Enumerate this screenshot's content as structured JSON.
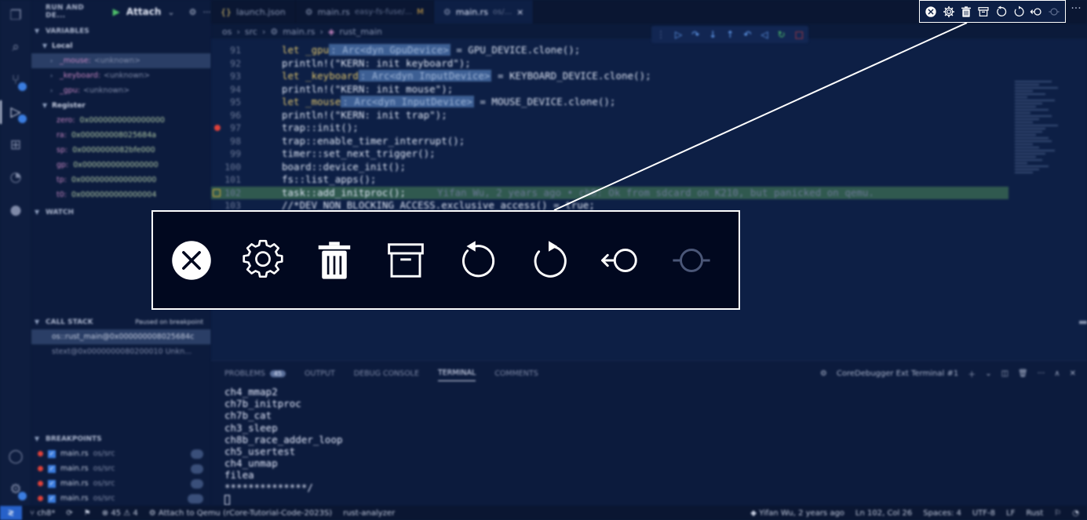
{
  "sidebar": {
    "run_label": "RUN AND DE...",
    "config": "Attach",
    "sections": {
      "variables": "VARIABLES",
      "local": "Local",
      "register": "Register",
      "watch": "WATCH",
      "call_stack": "CALL STACK",
      "call_stack_status": "Paused on breakpoint",
      "breakpoints": "BREAKPOINTS"
    },
    "locals": [
      {
        "name": "_mouse:",
        "value": "<unknown>"
      },
      {
        "name": "_keyboard:",
        "value": "<unknown>"
      },
      {
        "name": "_gpu:",
        "value": "<unknown>"
      }
    ],
    "registers": [
      {
        "name": "zero:",
        "value": "0x0000000000000000"
      },
      {
        "name": "ra:",
        "value": "0x000000008025684a"
      },
      {
        "name": "sp:",
        "value": "0x0000000082bfe000"
      },
      {
        "name": "gp:",
        "value": "0x0000000000000000"
      },
      {
        "name": "tp:",
        "value": "0x0000000000000000"
      },
      {
        "name": "t0:",
        "value": "0x0000000000000004"
      }
    ],
    "frames": [
      "os::rust_main@0x000000008025684c",
      "stext@0x0000000080200010  Unkn..."
    ],
    "breakpoints": [
      {
        "file": "main.rs",
        "path": "os/src"
      },
      {
        "file": "main.rs",
        "path": "os/src"
      },
      {
        "file": "main.rs",
        "path": "os/src"
      },
      {
        "file": "main.rs",
        "path": "os/src"
      }
    ]
  },
  "tabs": [
    {
      "label": "launch.json",
      "desc": "",
      "state": ""
    },
    {
      "label": "main.rs",
      "desc": "easy-fs-fuse/...",
      "state": "M"
    },
    {
      "label": "main.rs",
      "desc": "os/...",
      "state": "×"
    }
  ],
  "breadcrumb": {
    "a": "os",
    "b": "src",
    "c": "main.rs",
    "d": "rust_main"
  },
  "code": {
    "l91": "91",
    "l92": "92",
    "l93": "93",
    "l94": "94",
    "l95": "95",
    "l96": "96",
    "l97": "97",
    "l98": "98",
    "l99": "99",
    "l100": "100",
    "l101": "101",
    "l102": "102",
    "l103": "103",
    "gpu_var": "let _gpu",
    "gpu_hint": ": Arc<dyn GpuDevice>",
    "gpu_rest": " = GPU_DEVICE.clone();",
    "p_kbd": "println!(\"KERN: init keyboard\");",
    "kbd_var": "let _keyboard",
    "kbd_hint": ": Arc<dyn InputDevice>",
    "kbd_rest": " = KEYBOARD_DEVICE.clone();",
    "p_mouse": "println!(\"KERN: init mouse\");",
    "mouse_var": "let _mouse",
    "mouse_hint": ": Arc<dyn InputDevice>",
    "mouse_rest": " = MOUSE_DEVICE.clone();",
    "p_trap": "println!(\"KERN: init trap\");",
    "trap_init": "trap::init();",
    "trap_timer": "trap::enable_timer_interrupt();",
    "timer": "timer::set_next_trigger();",
    "board": "board::device_init();",
    "fs": "fs::list_apps();",
    "task": "task::add_initproc();",
    "blame": "Yifan Wu, 2 years ago • ch8: Ok from sdcard on K210, but panicked on qemu.",
    "comment": "//*DEV_NON_BLOCKING_ACCESS.exclusive_access() = true;"
  },
  "panel": {
    "tabs": [
      "PROBLEMS",
      "OUTPUT",
      "DEBUG CONSOLE",
      "TERMINAL",
      "COMMENTS"
    ],
    "active": "TERMINAL",
    "terminal_name": "CoreDebugger Ext Terminal #1",
    "terminal_lines": [
      "ch4_mmap2",
      "ch7b_initproc",
      "ch7b_cat",
      "ch3_sleep",
      "ch8b_race_adder_loop",
      "ch5_usertest",
      "ch4_unmap",
      "filea",
      "**************/"
    ]
  },
  "status": {
    "branch": "ch8*",
    "errors": "45",
    "warnings": "4",
    "launch": "Attach to Qemu (rCore-Tutorial-Code-2023S)",
    "analyzer": "rust-analyzer",
    "blame": "Yifan Wu, 2 years ago",
    "position": "Ln 102, Col 26",
    "spaces": "Spaces: 4",
    "encoding": "UTF-8",
    "eol": "LF",
    "language": "Rust"
  },
  "icons": {
    "notification_toolbar": [
      "close-circle-icon",
      "gear-icon",
      "trash-icon",
      "archive-icon",
      "undo-icon",
      "redo-icon",
      "back-circle-icon",
      "forward-circle-icon-disabled"
    ]
  },
  "colors": {
    "accent": "#3b7de0",
    "breakpoint": "#e0413a",
    "highlight_line": "#4a8a4a"
  }
}
